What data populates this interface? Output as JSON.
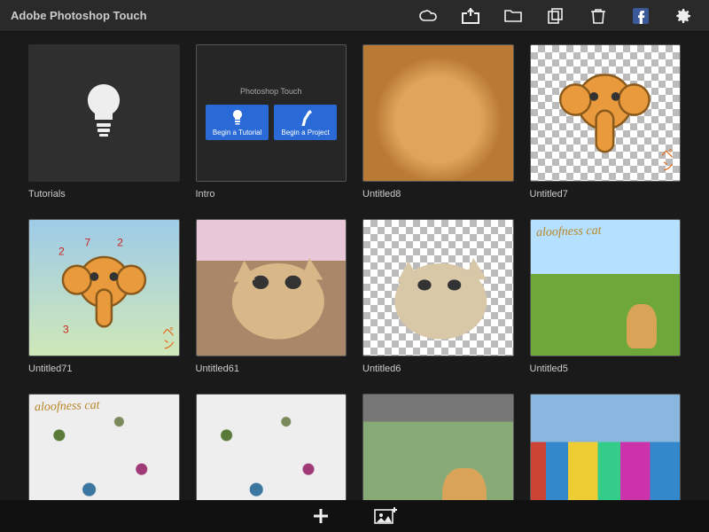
{
  "header": {
    "title": "Adobe Photoshop Touch"
  },
  "intro_card": {
    "title": "Photoshop Touch",
    "tutorial_btn": "Begin a Tutorial",
    "project_btn": "Begin a Project"
  },
  "projects": [
    {
      "label": "Tutorials",
      "kind": "tutorials"
    },
    {
      "label": "Intro",
      "kind": "intro"
    },
    {
      "label": "Untitled8",
      "kind": "plush"
    },
    {
      "label": "Untitled7",
      "kind": "elephant-checker",
      "overlay_text": "ペン"
    },
    {
      "label": "Untitled71",
      "kind": "elephant-annotated",
      "overlay_text": "ペン"
    },
    {
      "label": "Untitled61",
      "kind": "cat-paint-color"
    },
    {
      "label": "Untitled6",
      "kind": "cat-paint-checker"
    },
    {
      "label": "Untitled5",
      "kind": "cat-photo-text",
      "overlay_text": "aloofness cat"
    },
    {
      "label": "",
      "kind": "splatter-text",
      "overlay_text": "aloofness cat"
    },
    {
      "label": "",
      "kind": "splatter"
    },
    {
      "label": "",
      "kind": "cat-outdoor"
    },
    {
      "label": "",
      "kind": "street"
    }
  ]
}
